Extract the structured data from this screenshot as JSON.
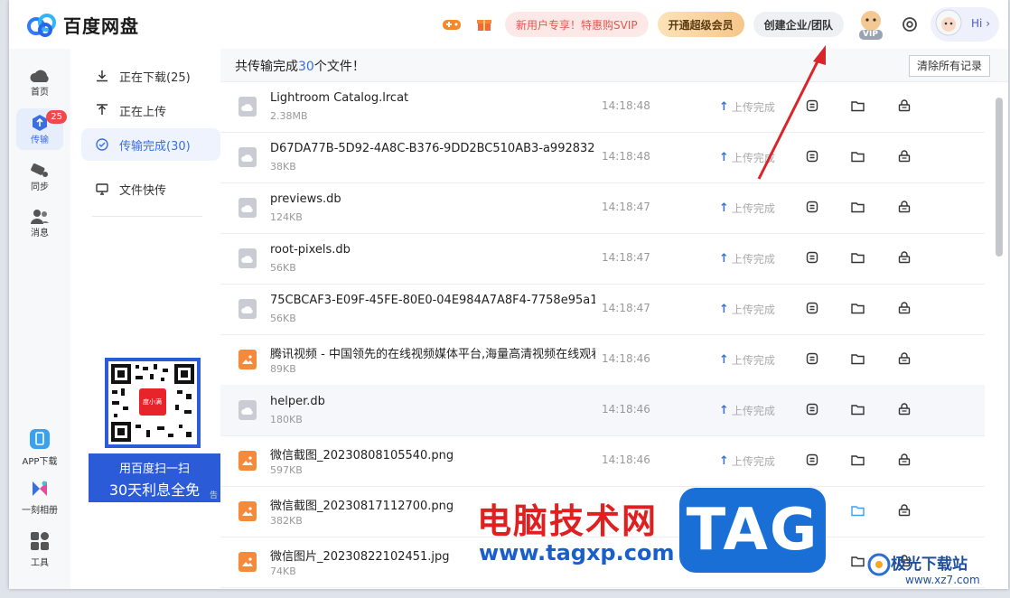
{
  "app": {
    "title": "百度网盘"
  },
  "topbar": {
    "promo_label": "新用户专享！特惠购SVIP",
    "svip_label": "开通超级会员",
    "enterprise_label": "创建企业/团队",
    "vip_tag": "VIP",
    "hi_label": "Hi ›"
  },
  "leftnav": {
    "items": [
      {
        "label": "首页"
      },
      {
        "label": "传输",
        "badge": "25"
      },
      {
        "label": "同步"
      },
      {
        "label": "消息"
      }
    ],
    "bottom": [
      {
        "label": "APP下载"
      },
      {
        "label": "一刻相册"
      },
      {
        "label": "工具"
      }
    ]
  },
  "subnav": {
    "items": [
      {
        "label": "正在下载(25)"
      },
      {
        "label": "正在上传"
      },
      {
        "label": "传输完成(30)"
      },
      {
        "label": "文件快传"
      }
    ],
    "qr": {
      "line1": "用百度扫一扫",
      "line2": "30天利息全免",
      "corner": "告",
      "inner": "度小满"
    }
  },
  "main": {
    "title_prefix": "共传输完成",
    "title_count": "30",
    "title_suffix": "个文件！",
    "clear_label": "清除所有记录",
    "rows": [
      {
        "name": "Lightroom Catalog.lrcat",
        "size": "2.38MB",
        "time": "14:18:48",
        "status": "上传完成",
        "icon": "grey"
      },
      {
        "name": "D67DA77B-5D92-4A8C-B376-9DD2BC510AB3-a9928321cdef...",
        "size": "38KB",
        "time": "14:18:48",
        "status": "上传完成",
        "icon": "grey"
      },
      {
        "name": "previews.db",
        "size": "124KB",
        "time": "14:18:47",
        "status": "上传完成",
        "icon": "grey"
      },
      {
        "name": "root-pixels.db",
        "size": "56KB",
        "time": "14:18:47",
        "status": "上传完成",
        "icon": "grey"
      },
      {
        "name": "75CBCAF3-E09F-45FE-80E0-04E984A7A8F4-7758e95a125538...",
        "size": "56KB",
        "time": "14:18:47",
        "status": "上传完成",
        "icon": "grey"
      },
      {
        "name": "腾讯视频 - 中国领先的在线视频媒体平台,海量高清视频在线观看_2...",
        "size": "89KB",
        "time": "14:18:46",
        "status": "上传完成",
        "icon": "orange"
      },
      {
        "name": "helper.db",
        "size": "180KB",
        "time": "14:18:46",
        "status": "上传完成",
        "icon": "grey"
      },
      {
        "name": "微信截图_20230808105540.png",
        "size": "597KB",
        "time": "14:18:46",
        "status": "上传完成",
        "icon": "orange"
      },
      {
        "name": "微信截图_20230817112700.png",
        "size": "382KB",
        "time": "",
        "status": "上传完成",
        "icon": "orange"
      },
      {
        "name": "微信图片_20230822102451.jpg",
        "size": "74KB",
        "time": "",
        "status": "上传完成",
        "icon": "orange"
      }
    ]
  },
  "watermark": {
    "cn": "电脑技术网",
    "url": "www.tagxp.com",
    "tag": "TAG",
    "jg_title": "极光下载站",
    "jg_url": "www.xz7.com"
  },
  "colors": {
    "accent": "#3b6fe0",
    "badge": "#f0494a",
    "arrow": "#d9252a"
  }
}
